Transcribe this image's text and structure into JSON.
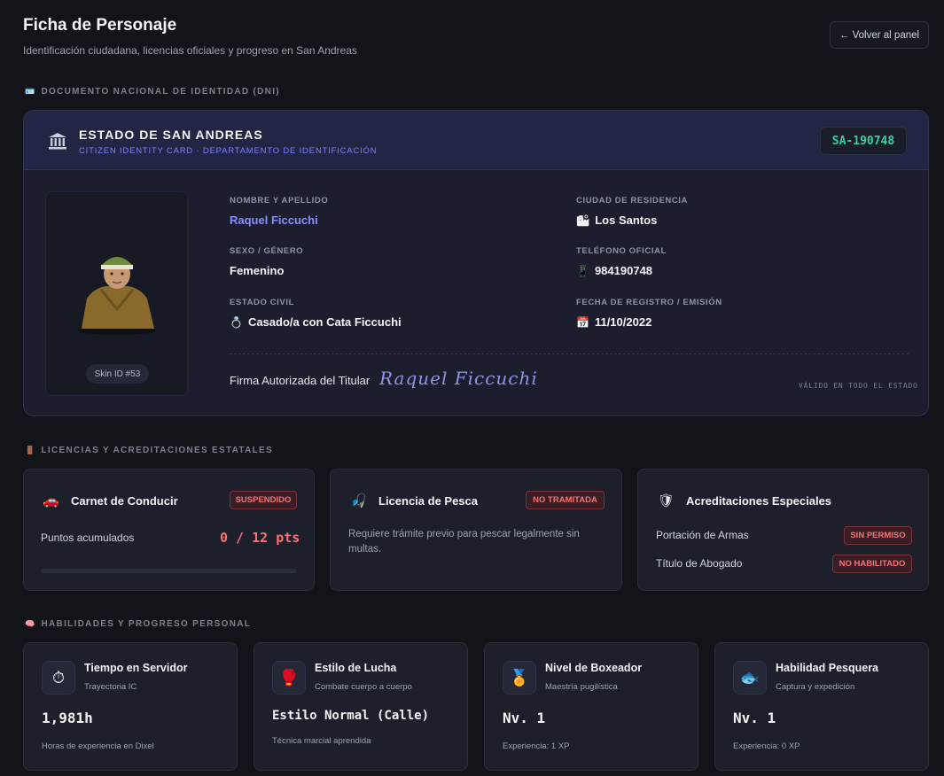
{
  "header": {
    "title": "Ficha de Personaje",
    "subtitle": "Identificación ciudadana, licencias oficiales y progreso en San Andreas",
    "back_button": "← Volver al panel"
  },
  "sections": {
    "dni": "DOCUMENTO NACIONAL DE IDENTIDAD (DNI)",
    "licenses": "LICENCIAS Y ACREDITACIONES ESTATALES",
    "skills": "HABILIDADES Y PROGRESO PERSONAL"
  },
  "dni": {
    "state": "ESTADO DE SAN ANDREAS",
    "subtitle": "CITIZEN IDENTITY CARD · DEPARTAMENTO DE IDENTIFICACIÓN",
    "id_number": "SA-190748",
    "skin_badge": "Skin ID #53",
    "fields": {
      "name": {
        "label": "NOMBRE Y APELLIDO",
        "value": "Raquel Ficcuchi"
      },
      "gender": {
        "label": "SEXO / GÉNERO",
        "value": "Femenino"
      },
      "civil": {
        "label": "ESTADO CIVIL",
        "icon": "💍",
        "value": "Casado/a con Cata Ficcuchi"
      },
      "city": {
        "label": "CIUDAD DE RESIDENCIA",
        "icon": "🏙",
        "value": "Los Santos"
      },
      "phone": {
        "label": "TELÉFONO OFICIAL",
        "icon": "📱",
        "value": "984190748"
      },
      "date": {
        "label": "FECHA DE REGISTRO / EMISIÓN",
        "icon": "📅",
        "value": "11/10/2022"
      }
    },
    "signature_label": "Firma Autorizada del Titular",
    "signature_name": "Raquel Ficcuchi",
    "valid_text": "VÁLIDO EN TODO EL ESTADO"
  },
  "licenses": {
    "driving": {
      "icon": "🚗",
      "title": "Carnet de Conducir",
      "status": "SUSPENDIDO",
      "points_label": "Puntos acumulados",
      "points": "0 / 12 pts",
      "progress_fraction": 0
    },
    "fishing": {
      "icon": "🎣",
      "title": "Licencia de Pesca",
      "status": "NO TRAMITADA",
      "description": "Requiere trámite previo para pescar legalmente sin multas."
    },
    "special": {
      "icon": "🛡",
      "title": "Acreditaciones Especiales",
      "rows": [
        {
          "label": "Portación de Armas",
          "status": "SIN PERMISO"
        },
        {
          "label": "Título de Abogado",
          "status": "NO HABILITADO"
        }
      ]
    }
  },
  "skills": [
    {
      "icon": "⏱",
      "title": "Tiempo en Servidor",
      "subtitle": "Trayectoria IC",
      "value": "1,981h",
      "footer": "Horas de experiencia en Dixel"
    },
    {
      "icon": "🥊",
      "title": "Estilo de Lucha",
      "subtitle": "Combate cuerpo a cuerpo",
      "value": "Estilo Normal (Calle)",
      "footer": "Técnica marcial aprendida"
    },
    {
      "icon": "🏅",
      "title": "Nivel de Boxeador",
      "subtitle": "Maestría pugilística",
      "value": "Nv. 1",
      "footer": "Experiencia: 1 XP"
    },
    {
      "icon": "🐟",
      "title": "Habilidad Pesquera",
      "subtitle": "Captura y expedición",
      "value": "Nv. 1",
      "footer": "Experiencia: 0 XP"
    }
  ],
  "colors": {
    "accent": "#8b8dff",
    "danger": "#f87171",
    "success": "#34d399",
    "background": "#131419"
  }
}
